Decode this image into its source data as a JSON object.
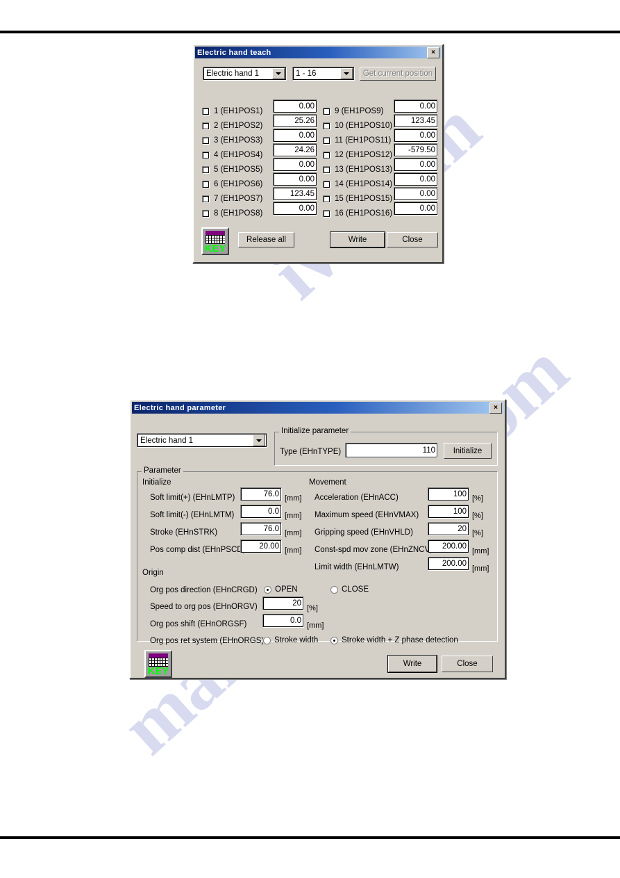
{
  "teach_dialog": {
    "title": "Electric hand teach",
    "close_label": "×",
    "hand_select": "Electric hand 1",
    "range_select": "1 - 16",
    "get_position_label": "Get current position",
    "positions_left": [
      {
        "label": "1 (EH1POS1)",
        "value": "0.00"
      },
      {
        "label": "2 (EH1POS2)",
        "value": "25.26"
      },
      {
        "label": "3 (EH1POS3)",
        "value": "0.00"
      },
      {
        "label": "4 (EH1POS4)",
        "value": "24.26"
      },
      {
        "label": "5 (EH1POS5)",
        "value": "0.00"
      },
      {
        "label": "6 (EH1POS6)",
        "value": "0.00"
      },
      {
        "label": "7 (EH1POS7)",
        "value": "123.45"
      },
      {
        "label": "8 (EH1POS8)",
        "value": "0.00"
      }
    ],
    "positions_right": [
      {
        "label": "9 (EH1POS9)",
        "value": "0.00"
      },
      {
        "label": "10 (EH1POS10)",
        "value": "123.45"
      },
      {
        "label": "11 (EH1POS11)",
        "value": "0.00"
      },
      {
        "label": "12 (EH1POS12)",
        "value": "-579.50"
      },
      {
        "label": "13 (EH1POS13)",
        "value": "0.00"
      },
      {
        "label": "14 (EH1POS14)",
        "value": "0.00"
      },
      {
        "label": "15 (EH1POS15)",
        "value": "0.00"
      },
      {
        "label": "16 (EH1POS16)",
        "value": "0.00"
      }
    ],
    "key_icon_text": "KEY",
    "release_all_label": "Release all",
    "write_label": "Write",
    "close_button_label": "Close"
  },
  "param_dialog": {
    "title": "Electric hand parameter",
    "close_label": "×",
    "hand_select": "Electric hand 1",
    "init_group_title": "Initialize parameter",
    "type_label": "Type (EHnTYPE)",
    "type_value": "110",
    "initialize_label": "Initialize",
    "parameter_group_title": "Parameter",
    "initialize_section_title": "Initialize",
    "movement_section_title": "Movement",
    "origin_section_title": "Origin",
    "initialize_fields": [
      {
        "label": "Soft limit(+) (EHnLMTP)",
        "value": "76.0",
        "unit": "[mm]"
      },
      {
        "label": "Soft limit(-) (EHnLMTM)",
        "value": "0.0",
        "unit": "[mm]"
      },
      {
        "label": "Stroke (EHnSTRK)",
        "value": "76.0",
        "unit": "[mm]"
      },
      {
        "label": "Pos comp dist (EHnPSCD)",
        "value": "20.00",
        "unit": "[mm]"
      }
    ],
    "movement_fields": [
      {
        "label": "Acceleration (EHnACC)",
        "value": "100",
        "unit": "[%]"
      },
      {
        "label": "Maximum speed (EHnVMAX)",
        "value": "100",
        "unit": "[%]"
      },
      {
        "label": "Gripping speed (EHnVHLD)",
        "value": "20",
        "unit": "[%]"
      },
      {
        "label": "Const-spd mov zone (EHnZNCV)",
        "value": "200.00",
        "unit": "[mm]"
      },
      {
        "label": "Limit width (EHnLMTW)",
        "value": "200.00",
        "unit": "[mm]"
      }
    ],
    "origin_direction_label": "Org pos direction (EHnCRGD)",
    "origin_direction_open": "OPEN",
    "origin_direction_close": "CLOSE",
    "origin_speed_label": "Speed to org pos (EHnORGV)",
    "origin_speed_value": "20",
    "origin_speed_unit": "[%]",
    "origin_shift_label": "Org pos shift (EHnORGSF)",
    "origin_shift_value": "0.0",
    "origin_shift_unit": "[mm]",
    "origin_ret_label": "Org pos ret system (EHnORGS)",
    "origin_ret_opt1": "Stroke width",
    "origin_ret_opt2": "Stroke width + Z phase detection",
    "key_icon_text": "KEY",
    "write_label": "Write",
    "close_button_label": "Close"
  },
  "watermark": {
    "line_a": "ive.com",
    "line_b": "manualshive.com"
  }
}
